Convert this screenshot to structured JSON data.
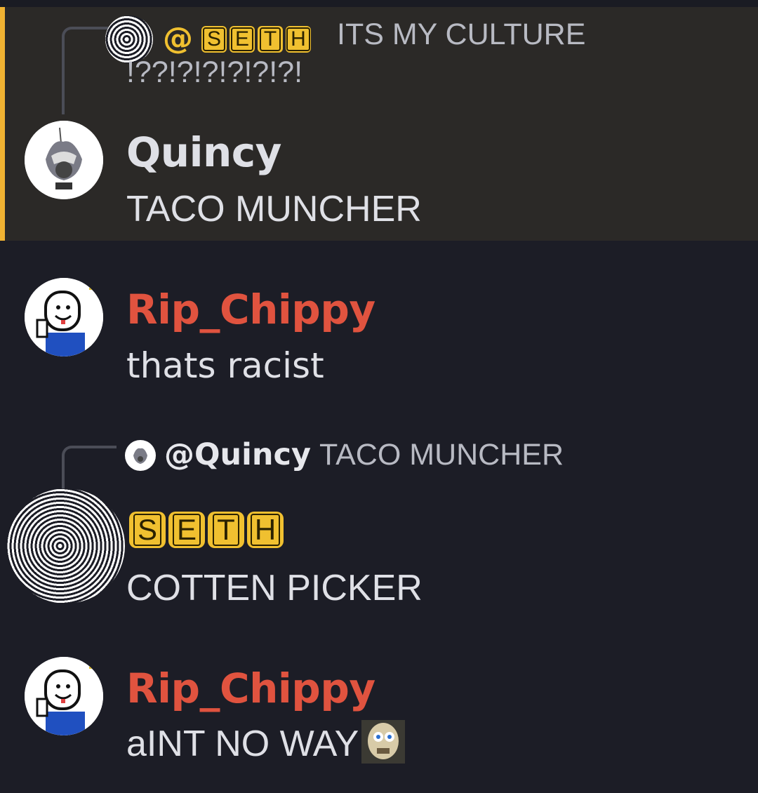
{
  "messages": [
    {
      "reply": {
        "mention": "@",
        "tag": [
          "S",
          "E",
          "T",
          "H"
        ],
        "text": "ITS MY CULTURE !??!?!?!?!?!?!"
      },
      "author": "Quincy",
      "author_color": "#eaeaea",
      "content": "TACO MUNCHER",
      "highlighted": true
    },
    {
      "author": "Rip_Chippy",
      "author_color": "#e0533f",
      "content": "thats racist"
    },
    {
      "reply": {
        "mention": "@Quincy",
        "text": "TACO MUNCHER"
      },
      "author_tag": [
        "S",
        "E",
        "T",
        "H"
      ],
      "content": "COTTEN PICKER"
    },
    {
      "author": "Rip_Chippy",
      "author_color": "#e0533f",
      "content": "aINT NO WAY"
    }
  ],
  "colors": {
    "background": "#1c1d26",
    "highlight_background": "#2b2927",
    "highlight_accent": "#f0b232",
    "tag_yellow": "#f0c030",
    "rip_chippy_name": "#e0533f"
  },
  "icons": [
    "scribbled-avatar",
    "quincy-avatar",
    "rip-chippy-avatar",
    "skull-emoji"
  ]
}
